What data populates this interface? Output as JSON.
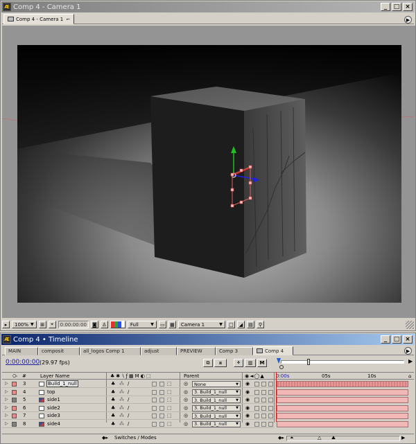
{
  "comp_window": {
    "title": "Comp 4 - Camera 1",
    "tab_label": "Comp 4 - Camera 1",
    "window_buttons": [
      "_",
      "□",
      "×"
    ],
    "footer": {
      "zoom": "100%",
      "timecode": "0:00:00:00",
      "resolution": "Full",
      "view": "Camera 1"
    }
  },
  "timeline_window": {
    "title": "Comp 4 • Timeline",
    "tabs": [
      "MAIN",
      "composit",
      "all_logos Comp 1",
      "adjust",
      "PREVIEW",
      "Comp 3",
      "Comp 4"
    ],
    "current_time": "0:00:00:00",
    "fps": "(29.97 fps)",
    "columns": {
      "label": "#",
      "layer_name": "Layer Name",
      "parent": "Parent"
    },
    "ruler": [
      "0:00s",
      "05s",
      "10s"
    ],
    "layers": [
      {
        "num": "3",
        "name": "Build_1_null",
        "label_color": "#e88a8a",
        "icon": "null",
        "parent": "None",
        "selected": true
      },
      {
        "num": "4",
        "name": "top",
        "label_color": "#e88a8a",
        "icon": "solid",
        "parent": "3. Build_1_null",
        "selected": false
      },
      {
        "num": "5",
        "name": "side1",
        "label_color": "#808080",
        "icon": "image",
        "parent": "3. Build_1_null",
        "selected": false
      },
      {
        "num": "6",
        "name": "side2",
        "label_color": "#e88a8a",
        "icon": "solid",
        "parent": "3. Build_1_null",
        "selected": false
      },
      {
        "num": "7",
        "name": "side3",
        "label_color": "#e88a8a",
        "icon": "solid",
        "parent": "3. Build_1_null",
        "selected": false
      },
      {
        "num": "8",
        "name": "side4",
        "label_color": "#808080",
        "icon": "image",
        "parent": "3. Build_1_null",
        "selected": false
      }
    ],
    "footer_label": "Switches / Modes"
  },
  "colors": {
    "active_title": "#0a246a",
    "inactive_title": "#808080",
    "track_bar": "#f2b8b8",
    "track_bar_selected": "#e89898",
    "accent_timecode": "#1a1aa0"
  }
}
